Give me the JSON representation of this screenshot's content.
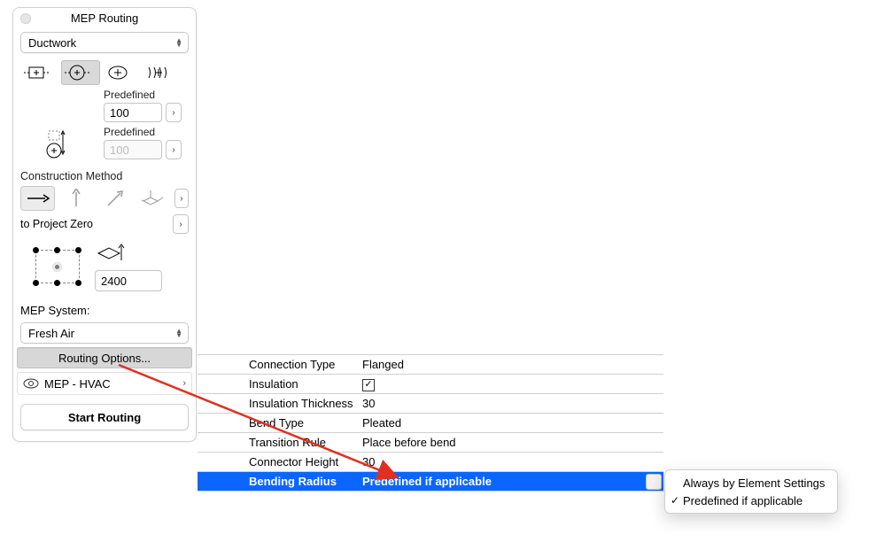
{
  "panel": {
    "title": "MEP Routing",
    "category_select": "Ductwork",
    "predef1_label": "Predefined",
    "predef1_value": "100",
    "predef2_label": "Predefined",
    "predef2_value": "100",
    "construction_label": "Construction Method",
    "reference_label": "to Project Zero",
    "elevation_value": "2400",
    "system_label": "MEP System:",
    "system_select": "Fresh Air",
    "routing_options": "Routing Options...",
    "layer_name": "MEP - HVAC",
    "start_routing": "Start Routing"
  },
  "options": {
    "rows": [
      {
        "label": "Connection Type",
        "value": "Flanged",
        "type": "text"
      },
      {
        "label": "Insulation",
        "value": "",
        "type": "check",
        "checked": true
      },
      {
        "label": "Insulation Thickness",
        "value": "30",
        "type": "text"
      },
      {
        "label": "Bend Type",
        "value": "Pleated",
        "type": "text"
      },
      {
        "label": "Transition Rule",
        "value": "Place before bend",
        "type": "text"
      },
      {
        "label": "Connector Height",
        "value": "30",
        "type": "text"
      },
      {
        "label": "Bending Radius",
        "value": "Predefined if applicable",
        "type": "select",
        "selected": true
      }
    ]
  },
  "popup": {
    "items": [
      {
        "label": "Always by Element Settings",
        "checked": false
      },
      {
        "label": "Predefined if applicable",
        "checked": true
      }
    ]
  }
}
